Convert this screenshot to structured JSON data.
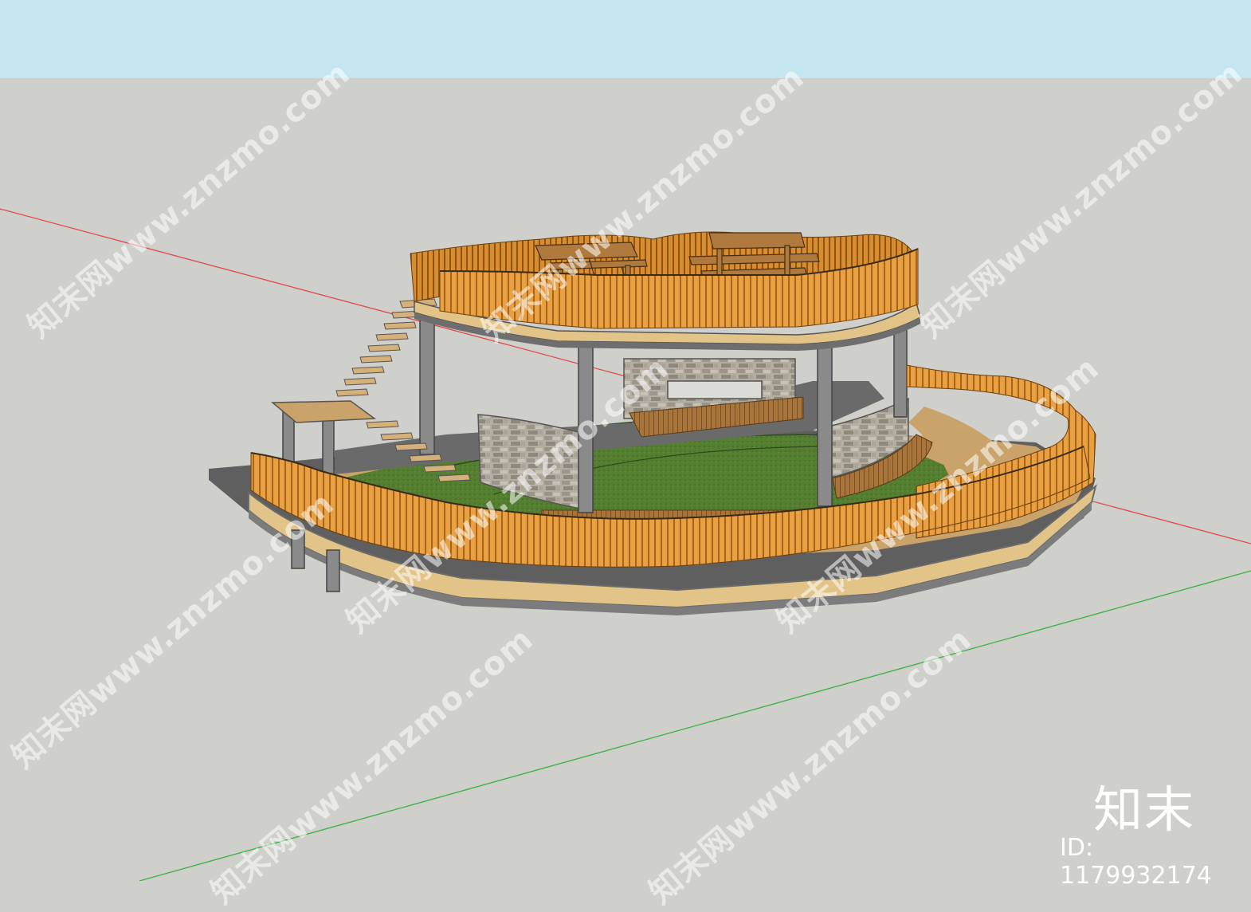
{
  "watermark": {
    "text": "知末网www.znzmo.com"
  },
  "logo": {
    "text": "知末",
    "id_label": "ID: 1179932174"
  },
  "colors": {
    "sky": "#c3e6f0",
    "ground": "#cfcfcb",
    "red_axis": "#e04a4a",
    "green_axis": "#3cb043",
    "rail": "#d9902e",
    "deck": "#c9a36a",
    "grass": "#4f7a2c",
    "stone": "#a39d92",
    "steel": "#8a8a8a"
  },
  "icons": [
    "red-axis-line",
    "green-axis-line",
    "pavilion-model"
  ]
}
